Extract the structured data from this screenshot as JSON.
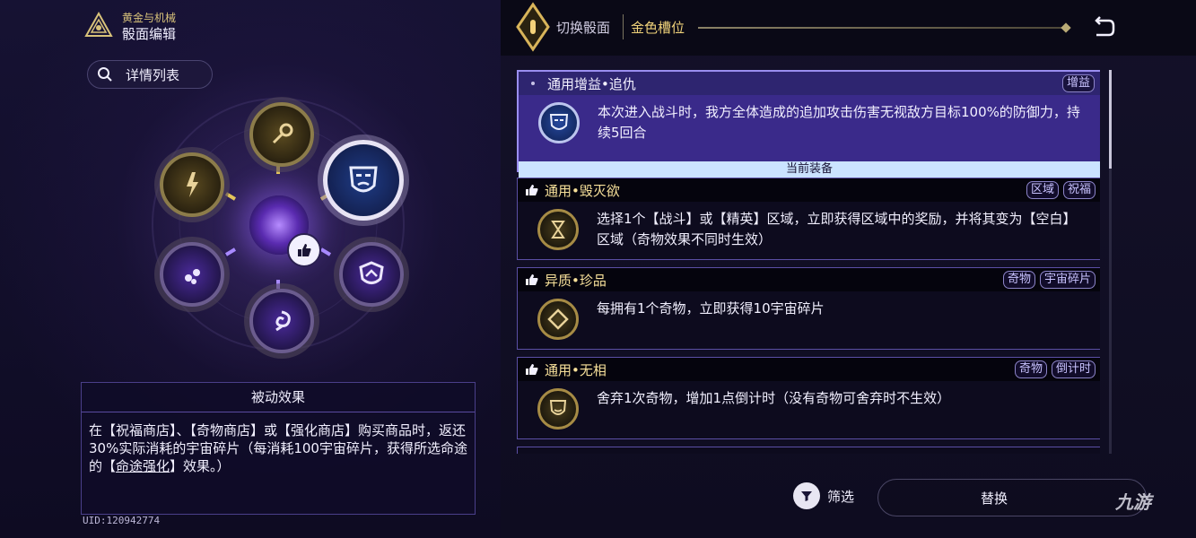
{
  "brand": {
    "subtitle": "黄金与机械",
    "title": "骰面编辑"
  },
  "search": {
    "label": "详情列表"
  },
  "passive": {
    "title": "被动效果",
    "text_before": "在【祝福商店】、【奇物商店】或【强化商店】购买商品时，返还30%实际消耗的宇宙碎片（每消耗100宇宙碎片，获得所选命途的【",
    "text_link": "命途强化",
    "text_after": "】效果。）"
  },
  "uid": "UID:120942774",
  "topbar": {
    "switch_label": "切换骰面",
    "slot_label": "金色槽位"
  },
  "cards": [
    {
      "title": "通用增益•追仇",
      "tags": [
        "增益"
      ],
      "desc": "本次进入战斗时，我方全体造成的追加攻击伤害无视敌方目标100%的防御力，持续5回合",
      "equipped": "当前装备",
      "icon": "mask-icon"
    },
    {
      "title": "通用•毁灭欲",
      "tags": [
        "区域",
        "祝福"
      ],
      "desc": "选择1个【战斗】或【精英】区域，立即获得区域中的奖励，并将其变为【空白】区域（奇物效果不同时生效）",
      "icon": "hourglass-icon"
    },
    {
      "title": "异质•珍品",
      "tags": [
        "奇物",
        "宇宙碎片"
      ],
      "desc": "每拥有1个奇物，立即获得10宇宙碎片",
      "icon": "diamond-icon"
    },
    {
      "title": "通用•无相",
      "tags": [
        "奇物",
        "倒计时"
      ],
      "desc": "舍弃1次奇物，增加1点倒计时（没有奇物可舍弃时不生效）",
      "icon": "mask-icon"
    }
  ],
  "bottom": {
    "filter_label": "筛选",
    "replace_label": "替换"
  },
  "watermark": "九游",
  "colors": {
    "accent_gold": "#f0d27a",
    "active_card": "#3a2a8a",
    "equipped_bar": "#cbe3ff"
  }
}
